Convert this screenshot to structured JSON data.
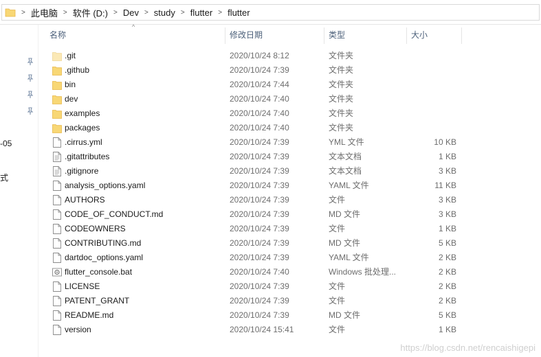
{
  "breadcrumb": [
    "此电脑",
    "软件 (D:)",
    "Dev",
    "study",
    "flutter",
    "flutter"
  ],
  "columns": {
    "name": "名称",
    "date": "修改日期",
    "type": "类型",
    "size": "大小"
  },
  "nav_fragments": [
    "-05",
    "式"
  ],
  "files": [
    {
      "name": ".git",
      "date": "2020/10/24 8:12",
      "type": "文件夹",
      "size": "",
      "icon": "folder-faded"
    },
    {
      "name": ".github",
      "date": "2020/10/24 7:39",
      "type": "文件夹",
      "size": "",
      "icon": "folder"
    },
    {
      "name": "bin",
      "date": "2020/10/24 7:44",
      "type": "文件夹",
      "size": "",
      "icon": "folder"
    },
    {
      "name": "dev",
      "date": "2020/10/24 7:40",
      "type": "文件夹",
      "size": "",
      "icon": "folder"
    },
    {
      "name": "examples",
      "date": "2020/10/24 7:40",
      "type": "文件夹",
      "size": "",
      "icon": "folder"
    },
    {
      "name": "packages",
      "date": "2020/10/24 7:40",
      "type": "文件夹",
      "size": "",
      "icon": "folder"
    },
    {
      "name": ".cirrus.yml",
      "date": "2020/10/24 7:39",
      "type": "YML 文件",
      "size": "10 KB",
      "icon": "file"
    },
    {
      "name": ".gitattributes",
      "date": "2020/10/24 7:39",
      "type": "文本文档",
      "size": "1 KB",
      "icon": "text"
    },
    {
      "name": ".gitignore",
      "date": "2020/10/24 7:39",
      "type": "文本文档",
      "size": "3 KB",
      "icon": "text"
    },
    {
      "name": "analysis_options.yaml",
      "date": "2020/10/24 7:39",
      "type": "YAML 文件",
      "size": "11 KB",
      "icon": "file"
    },
    {
      "name": "AUTHORS",
      "date": "2020/10/24 7:39",
      "type": "文件",
      "size": "3 KB",
      "icon": "file"
    },
    {
      "name": "CODE_OF_CONDUCT.md",
      "date": "2020/10/24 7:39",
      "type": "MD 文件",
      "size": "3 KB",
      "icon": "file"
    },
    {
      "name": "CODEOWNERS",
      "date": "2020/10/24 7:39",
      "type": "文件",
      "size": "1 KB",
      "icon": "file"
    },
    {
      "name": "CONTRIBUTING.md",
      "date": "2020/10/24 7:39",
      "type": "MD 文件",
      "size": "5 KB",
      "icon": "file"
    },
    {
      "name": "dartdoc_options.yaml",
      "date": "2020/10/24 7:39",
      "type": "YAML 文件",
      "size": "2 KB",
      "icon": "file"
    },
    {
      "name": "flutter_console.bat",
      "date": "2020/10/24 7:40",
      "type": "Windows 批处理...",
      "size": "2 KB",
      "icon": "bat"
    },
    {
      "name": "LICENSE",
      "date": "2020/10/24 7:39",
      "type": "文件",
      "size": "2 KB",
      "icon": "file"
    },
    {
      "name": "PATENT_GRANT",
      "date": "2020/10/24 7:39",
      "type": "文件",
      "size": "2 KB",
      "icon": "file"
    },
    {
      "name": "README.md",
      "date": "2020/10/24 7:39",
      "type": "MD 文件",
      "size": "5 KB",
      "icon": "file"
    },
    {
      "name": "version",
      "date": "2020/10/24 15:41",
      "type": "文件",
      "size": "1 KB",
      "icon": "file"
    }
  ],
  "watermark": "https://blog.csdn.net/rencaishigepi",
  "colors": {
    "folder": "#f8d775",
    "folder_dark": "#e8b84a",
    "header_text": "#4c607a"
  }
}
